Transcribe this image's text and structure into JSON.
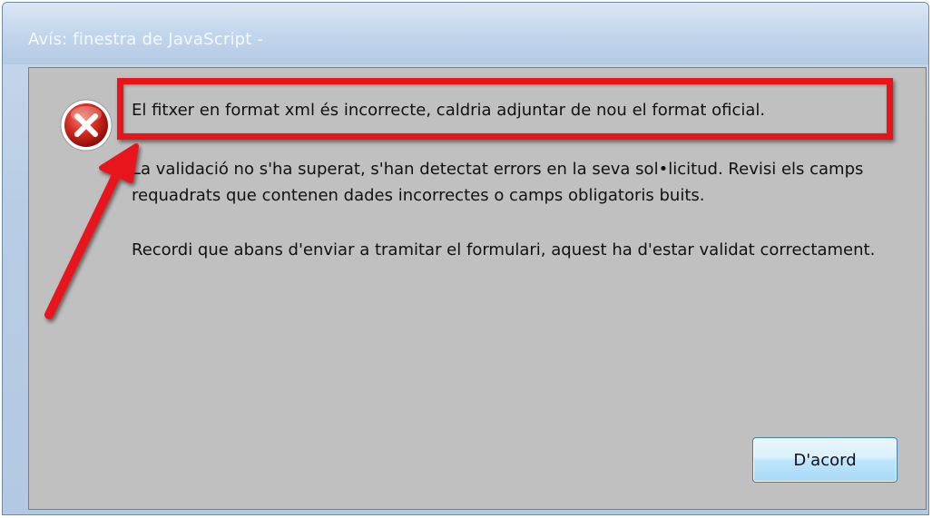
{
  "window": {
    "title": "Avís: finestra de JavaScript -"
  },
  "dialog": {
    "icon": "error-icon",
    "message_main": "El fitxer en format xml és incorrecte, caldria adjuntar de nou el format oficial.",
    "message_validation": "La validació no s'ha superat, s'han detectat errors en la seva sol•licitud. Revisi els camps requadrats que contenen dades incorrectes o camps obligatoris buits.",
    "message_reminder": "Recordi que abans d'enviar a tramitar el formulari, aquest ha d'estar validat correctament."
  },
  "buttons": {
    "ok_label": "D'acord"
  },
  "colors": {
    "annotation_red": "#e8141a",
    "dialog_bg": "#c0c0c0",
    "titlebar": "#c3d6ec"
  }
}
